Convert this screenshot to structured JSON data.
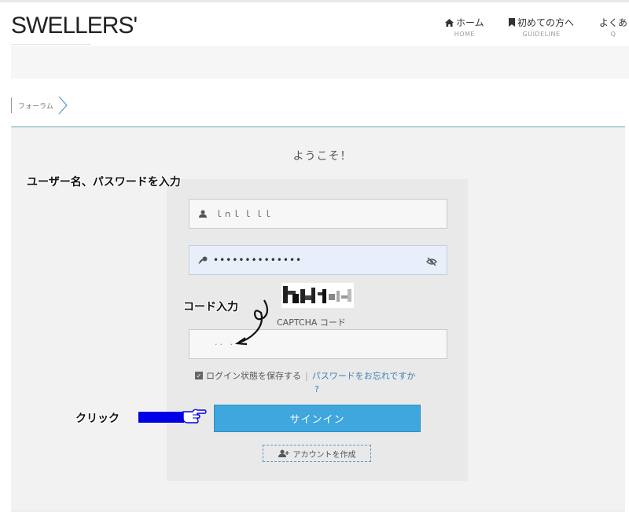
{
  "header": {
    "logo": "SWELLERS'",
    "nav": [
      {
        "label": "ホーム",
        "sub": "HOME",
        "icon": "home-icon"
      },
      {
        "label": "初めての方へ",
        "sub": "GUIDELINE",
        "icon": "bookmark-icon"
      },
      {
        "label": "よくあ",
        "sub": "Q"
      }
    ]
  },
  "breadcrumb": {
    "label": "フォーラム"
  },
  "login": {
    "welcome": "ようこそ！",
    "username_value": "ｌｎｌ ｌ ｌｌ",
    "password_value": "••••••••••••••",
    "captcha_label": "CAPTCHA コード",
    "code_value": "·· · ·",
    "remember_label": "ログイン状態を保存する",
    "separator": "|",
    "forgot_label": "パスワードをお忘れですか",
    "forgot_q": "?",
    "signin_label": "サインイン",
    "create_label": "アカウントを作成"
  },
  "annotations": {
    "username_pass": "ユーザー名、パスワードを入力",
    "code": "コード入力",
    "click": "クリック"
  },
  "colors": {
    "accent": "#3fa6de",
    "link": "#3d7fb5",
    "annotation_bar": "#0000e6"
  }
}
